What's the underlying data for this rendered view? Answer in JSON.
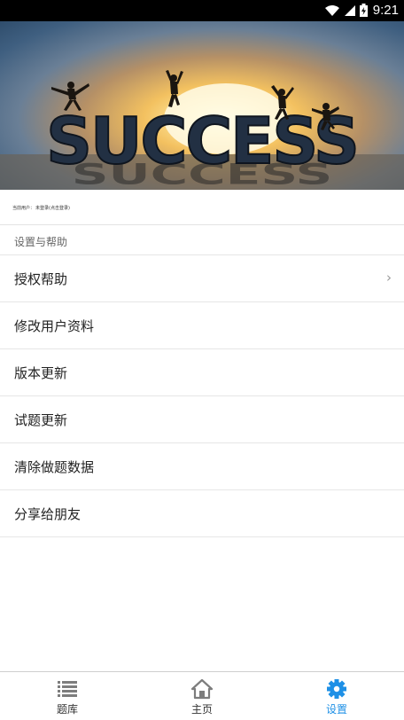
{
  "status_bar": {
    "time": "9:21"
  },
  "banner": {
    "text": "SUCCESS"
  },
  "user": {
    "label": "当前用户：",
    "value": "未登录(点击登录)"
  },
  "section": {
    "title": "设置与帮助"
  },
  "menu": {
    "items": [
      {
        "label": "授权帮助",
        "chevron": "›"
      },
      {
        "label": "修改用户资料"
      },
      {
        "label": "版本更新"
      },
      {
        "label": "试题更新"
      },
      {
        "label": "清除做题数据"
      },
      {
        "label": "分享给朋友"
      }
    ]
  },
  "tabs": [
    {
      "label": "题库",
      "icon": "list-icon"
    },
    {
      "label": "主页",
      "icon": "home-icon"
    },
    {
      "label": "设置",
      "icon": "gear-icon",
      "active": true
    }
  ],
  "colors": {
    "accent": "#1e90e6",
    "divider": "#e6e6e6",
    "statusbar": "#000000"
  }
}
